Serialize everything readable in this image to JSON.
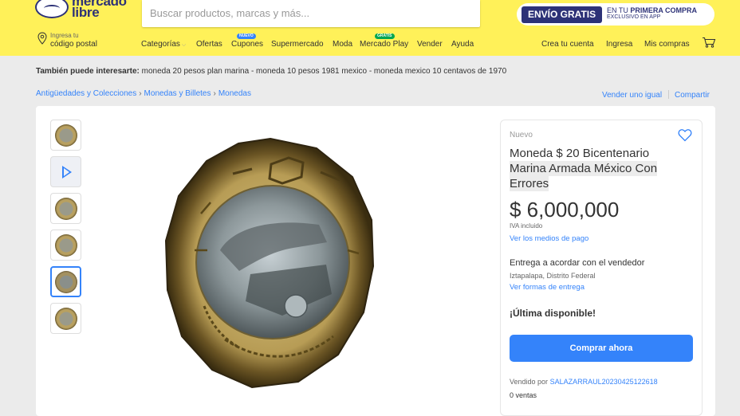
{
  "header": {
    "logo_line1": "mercado",
    "logo_line2": "libre",
    "search_placeholder": "Buscar productos, marcas y más...",
    "promo_pill": "ENVÍO GRATIS",
    "promo_line1_pre": "EN TU ",
    "promo_line1_bold": "PRIMERA COMPRA",
    "promo_line2": "EXCLUSIVO EN APP",
    "location_small": "Ingresa tu",
    "location_big": "código postal",
    "nav": {
      "categorias": "Categorías",
      "ofertas": "Ofertas",
      "cupones": "Cupones",
      "cupones_badge": "NUEVO",
      "supermercado": "Supermercado",
      "moda": "Moda",
      "mercado_play": "Mercado Play",
      "mercado_play_badge": "GRATIS",
      "vender": "Vender",
      "ayuda": "Ayuda",
      "crea_cuenta": "Crea tu cuenta",
      "ingresa": "Ingresa",
      "mis_compras": "Mis compras"
    },
    "colors": {
      "yellow": "#fff159",
      "navy": "#2d3277",
      "cupones_badge": "#3483fa",
      "play_badge": "#00a650"
    }
  },
  "related": {
    "label": "También puede interesarte:",
    "items": "moneda 20 pesos plan marina - moneda 10 pesos 1981 mexico - moneda mexico 10 centavos de 1970"
  },
  "breadcrumb": {
    "items": [
      "Antigüedades y Colecciones",
      "Monedas y Billetes",
      "Monedas"
    ],
    "separator": "›"
  },
  "actions": {
    "sell_same": "Vender uno igual",
    "share": "Compartir"
  },
  "gallery": {
    "thumbnails": [
      "coin-thumb",
      "video-thumb",
      "coin-thumb",
      "coin-thumb",
      "coin-thumb",
      "coin-thumb"
    ],
    "selected_index": 4
  },
  "product": {
    "condition": "Nuevo",
    "title_line1": "Moneda $ 20 Bicentenario",
    "title_line2": "Marina Armada México Con",
    "title_line3": "Errores",
    "price": "$ 6,000,000",
    "iva": "IVA incluido",
    "payment_link": "Ver los medios de pago",
    "delivery": "Entrega a acordar con el vendedor",
    "city": "Iztapalapa, Distrito Federal",
    "delivery_link": "Ver formas de entrega",
    "stock": "¡Última disponible!",
    "buy_button": "Comprar ahora",
    "seller_label": "Vendido por",
    "seller_name": "SALAZARRAUL20230425122618",
    "sales": "0 ventas",
    "accent_color": "#3483fa"
  }
}
